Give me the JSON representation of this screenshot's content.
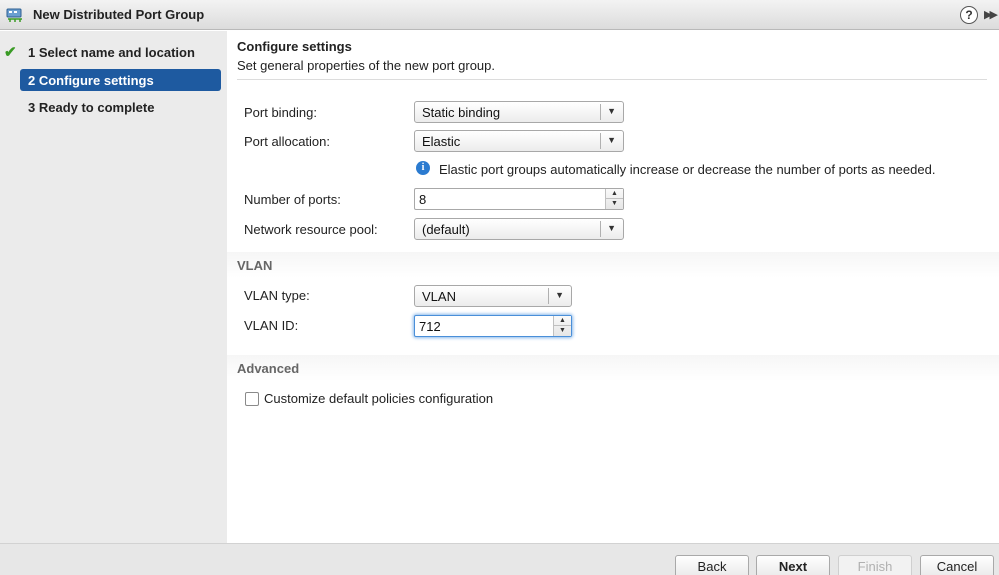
{
  "window": {
    "title": "New Distributed Port Group",
    "help_label": "?",
    "expand_label": "▶▶"
  },
  "steps": [
    {
      "label": "1  Select name and location",
      "state": "done"
    },
    {
      "label": "2  Configure settings",
      "state": "active"
    },
    {
      "label": "3  Ready to complete",
      "state": "pending"
    }
  ],
  "main": {
    "title": "Configure settings",
    "subtitle": "Set general properties of the new port group."
  },
  "fields": {
    "port_binding": {
      "label": "Port binding:",
      "value": "Static binding"
    },
    "port_allocation": {
      "label": "Port allocation:",
      "value": "Elastic"
    },
    "allocation_info": "Elastic port groups automatically increase or decrease the number of ports as needed.",
    "number_of_ports": {
      "label": "Number of ports:",
      "value": "8"
    },
    "resource_pool": {
      "label": "Network resource pool:",
      "value": "(default)"
    }
  },
  "vlan": {
    "section_title": "VLAN",
    "type": {
      "label": "VLAN type:",
      "value": "VLAN"
    },
    "id": {
      "label": "VLAN ID:",
      "value": "712"
    }
  },
  "advanced": {
    "section_title": "Advanced",
    "customize_label": "Customize default policies configuration",
    "customize_checked": false
  },
  "footer": {
    "back": "Back",
    "next": "Next",
    "finish": "Finish",
    "cancel": "Cancel"
  },
  "colors": {
    "active_step": "#1e5aa0",
    "check": "#3a9b25",
    "info": "#2b7bd0"
  },
  "icons": {
    "arrow": "▼",
    "spin_up": "▲",
    "spin_down": "▼",
    "check": "✔",
    "info": "i"
  }
}
